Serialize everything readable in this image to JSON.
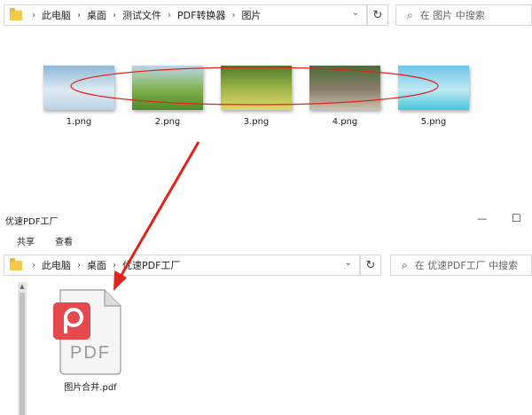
{
  "top_window": {
    "breadcrumb": [
      "此电脑",
      "桌面",
      "测试文件",
      "PDF转换器",
      "图片"
    ],
    "search_placeholder": "在 图片 中搜索",
    "files": [
      {
        "name": "1.png",
        "thumb_colors": [
          "#8fb8d8",
          "#dfeaf3",
          "#b9d2e6"
        ]
      },
      {
        "name": "2.png",
        "thumb_colors": [
          "#bcd7ea",
          "#7fb04a",
          "#4f8a2a"
        ]
      },
      {
        "name": "3.png",
        "thumb_colors": [
          "#4e7a2b",
          "#a3b94a",
          "#e1d66a"
        ]
      },
      {
        "name": "4.png",
        "thumb_colors": [
          "#4a6b3a",
          "#8b7f6a",
          "#c9c2b0"
        ]
      },
      {
        "name": "5.png",
        "thumb_colors": [
          "#6fc4ea",
          "#bfe9f3",
          "#43c9d9"
        ]
      }
    ]
  },
  "bottom_window": {
    "title": "优速PDF工厂",
    "ribbon": [
      "共享",
      "查看"
    ],
    "breadcrumb": [
      "此电脑",
      "桌面",
      "优速PDF工厂"
    ],
    "search_placeholder": "在 优速PDF工厂 中搜索",
    "file": {
      "name": "图片合并.pdf",
      "icon_text": "PDF"
    },
    "controls": {
      "minimize": "—",
      "maximize": "☐"
    }
  },
  "icons": {
    "dropdown": "⌄",
    "refresh": "↻",
    "search": "⌕",
    "chevron": "›",
    "scroll_up": "▲"
  },
  "colors": {
    "annotation_red": "#e2231a",
    "pdf_badge": "#e5484d",
    "folder": "#f2c94c"
  }
}
